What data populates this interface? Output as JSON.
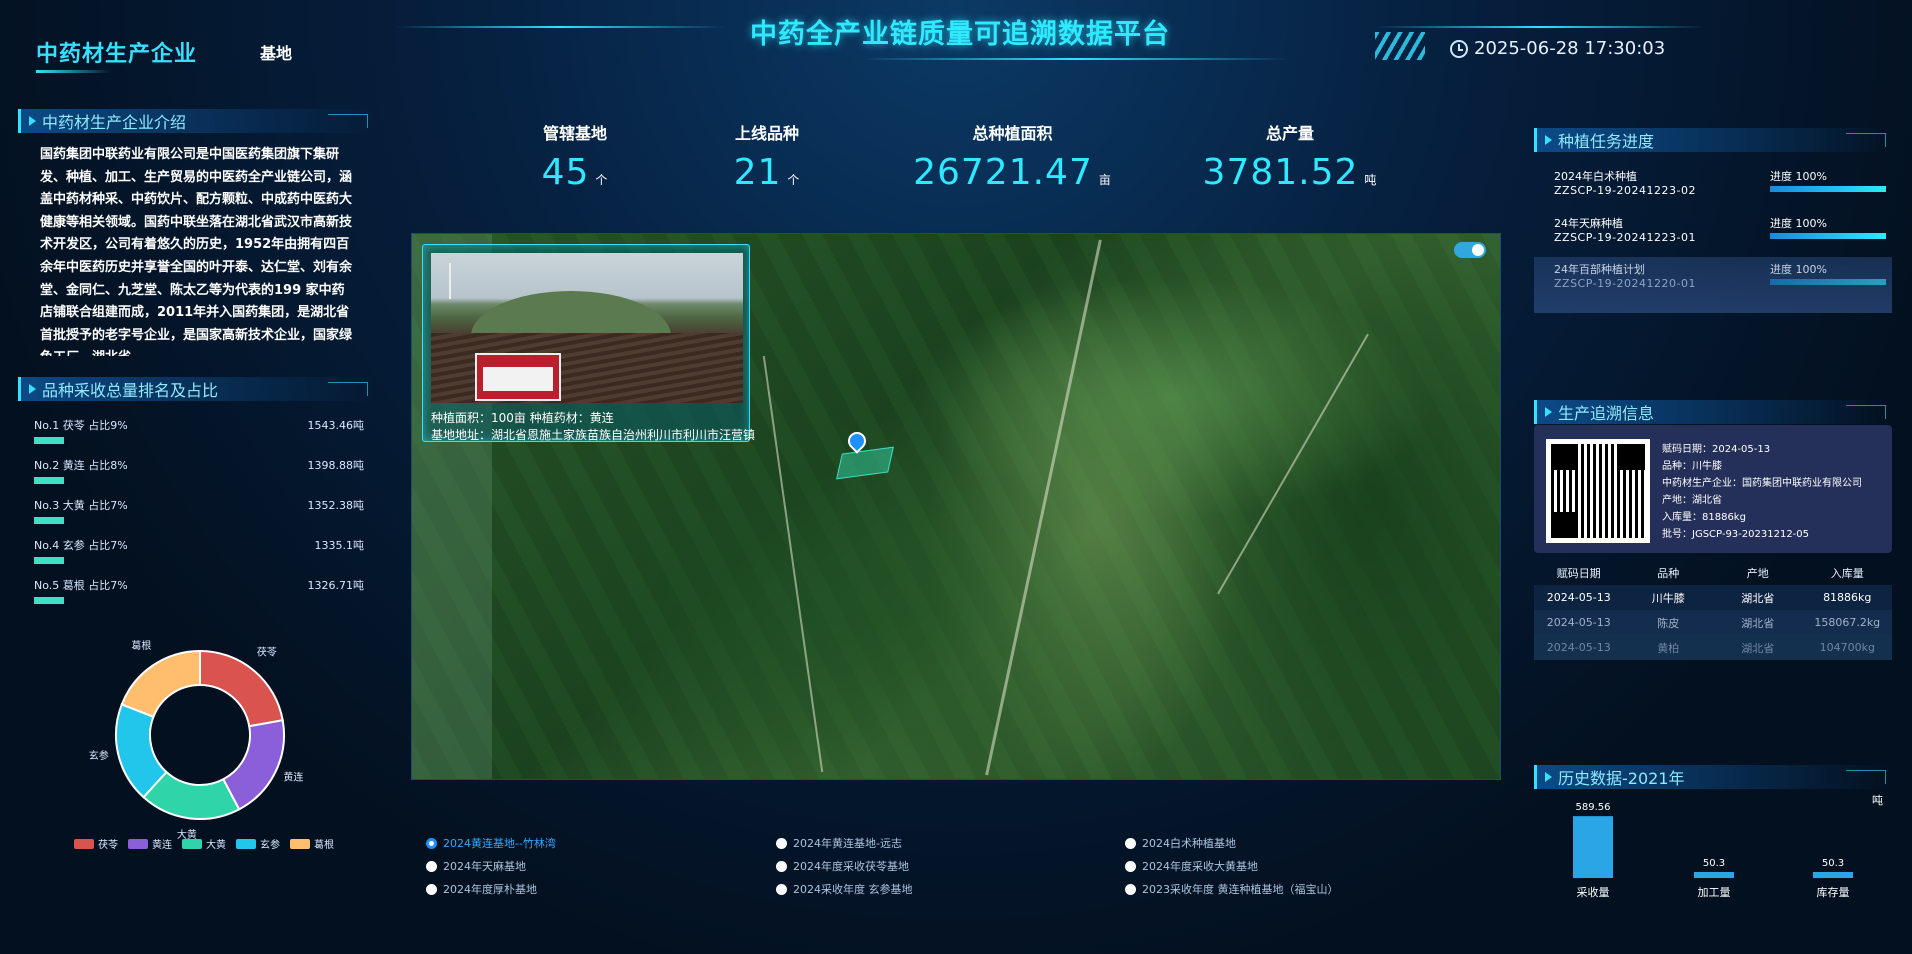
{
  "header": {
    "company_tab": "中药材生产企业",
    "base_tab": "基地",
    "title": "中药全产业链质量可追溯数据平台",
    "datetime": "2025-06-28 17:30:03"
  },
  "intro": {
    "title": "中药材生产企业介绍",
    "text": "国药集团中联药业有限公司是中国医药集团旗下集研发、种植、加工、生产贸易的中医药全产业链公司，涵盖中药材种采、中药饮片、配方颗粒、中成药中医药大健康等相关领域。国药中联坐落在湖北省武汉市高新技术开发区，公司有着悠久的历史，1952年由拥有四百余年中医药历史并享誉全国的叶开泰、达仁堂、刘有余堂、金同仁、九芝堂、陈太乙等为代表的199 家中药店铺联合组建而成，2011年并入国药集团，是湖北省首批授予的老字号企业，是国家高新技术企业，国家绿色工厂，湖北省"
  },
  "ranking": {
    "title": "品种采收总量排名及占比",
    "items": [
      {
        "label": "No.1 茯苓 占比9%",
        "value": "1543.46吨"
      },
      {
        "label": "No.2 黄连 占比8%",
        "value": "1398.88吨"
      },
      {
        "label": "No.3 大黄 占比7%",
        "value": "1352.38吨"
      },
      {
        "label": "No.4 玄参 占比7%",
        "value": "1335.1吨"
      },
      {
        "label": "No.5 葛根 占比7%",
        "value": "1326.71吨"
      }
    ]
  },
  "donut": {
    "slices": [
      {
        "name": "茯苓",
        "value": 1543.46,
        "color": "#d9534f"
      },
      {
        "name": "黄连",
        "value": 1398.88,
        "color": "#8a5fd9"
      },
      {
        "name": "大黄",
        "value": 1352.38,
        "color": "#2fd4a8"
      },
      {
        "name": "玄参",
        "value": 1335.1,
        "color": "#22c6ea"
      },
      {
        "name": "葛根",
        "value": 1326.71,
        "color": "#ffbe6e"
      }
    ]
  },
  "stats": [
    {
      "label": "管辖基地",
      "value": "45",
      "unit": "个"
    },
    {
      "label": "上线品种",
      "value": "21",
      "unit": "个"
    },
    {
      "label": "总种植面积",
      "value": "26721.47",
      "unit": "亩"
    },
    {
      "label": "总产量",
      "value": "3781.52",
      "unit": "吨"
    }
  ],
  "map": {
    "popup": {
      "line1": "种植面积：100亩      种植药材：黄连",
      "line2": "基地地址：湖北省恩施土家族苗族自治州利川市利川市汪营镇"
    }
  },
  "bases": [
    {
      "label": "2024黄连基地--竹林湾",
      "selected": true
    },
    {
      "label": "2024年天麻基地",
      "selected": false
    },
    {
      "label": "2024年度厚朴基地",
      "selected": false
    },
    {
      "label": "2024年黄连基地-远志",
      "selected": false
    },
    {
      "label": "2024年度采收茯苓基地",
      "selected": false
    },
    {
      "label": "2024采收年度 玄参基地",
      "selected": false
    },
    {
      "label": "2024白术种植基地",
      "selected": false
    },
    {
      "label": "2024年度采收大黄基地",
      "selected": false
    },
    {
      "label": "2023采收年度 黄连种植基地（福宝山）",
      "selected": false
    }
  ],
  "tasks": {
    "title": "种植任务进度",
    "items": [
      {
        "name": "2024年白术种植",
        "code": "ZZSCP-19-20241223-02",
        "progress": "进度 100%"
      },
      {
        "name": "24年天麻种植",
        "code": "ZZSCP-19-20241223-01",
        "progress": "进度 100%"
      },
      {
        "name": "24年百部种植计划",
        "code": "ZZSCP-19-20241220-01",
        "progress": "进度 100%"
      }
    ]
  },
  "trace": {
    "title": "生产追溯信息",
    "info": [
      "赋码日期：2024-05-13",
      "品种：川牛膝",
      "中药材生产企业：国药集团中联药业有限公司",
      "产地：湖北省",
      "入库量：81886kg",
      "批号：JGSCP-93-20231212-05"
    ],
    "table": {
      "headers": [
        "赋码日期",
        "品种",
        "产地",
        "入库量"
      ],
      "rows": [
        [
          "2024-05-13",
          "川牛膝",
          "湖北省",
          "81886kg"
        ],
        [
          "2024-05-13",
          "陈皮",
          "湖北省",
          "158067.2kg"
        ],
        [
          "2024-05-13",
          "黄柏",
          "湖北省",
          "104700kg"
        ]
      ]
    }
  },
  "history": {
    "title": "历史数据-2021年",
    "unit": "吨"
  },
  "chart_data": {
    "type": "bar",
    "categories": [
      "采收量",
      "加工量",
      "库存量"
    ],
    "values": [
      589.56,
      50.3,
      50.3
    ],
    "ylim": [
      0,
      650
    ]
  }
}
